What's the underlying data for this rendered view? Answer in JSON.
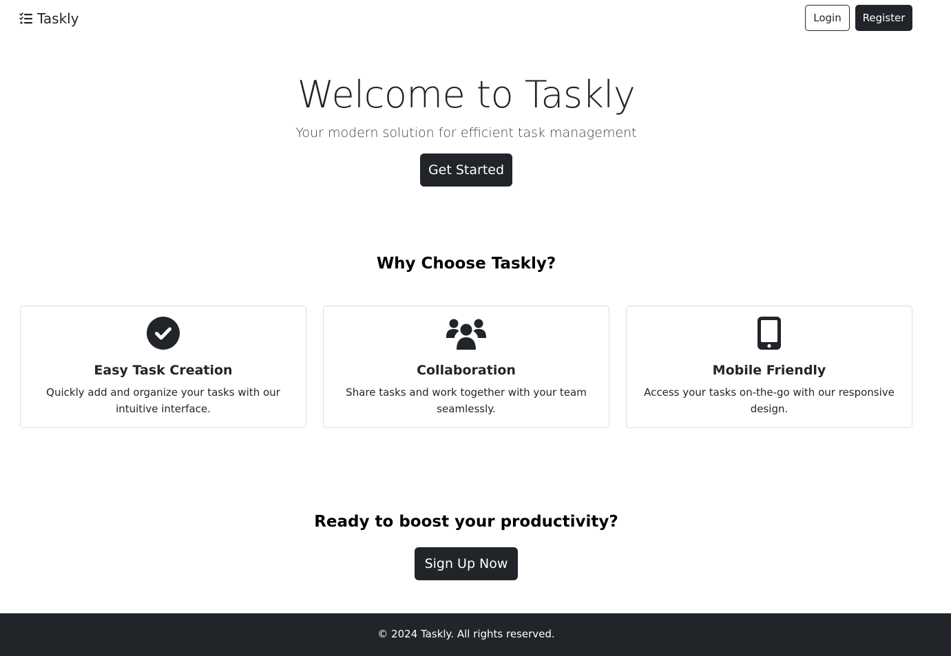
{
  "navbar": {
    "brand_icon": "task-list-icon",
    "brand_label": "Taskly",
    "login_label": "Login",
    "register_label": "Register"
  },
  "hero": {
    "title": "Welcome to Taskly",
    "subtitle": "Your modern solution for efficient task management",
    "cta_label": "Get Started"
  },
  "features": {
    "heading": "Why Choose Taskly?",
    "items": [
      {
        "icon": "check-circle-icon",
        "title": "Easy Task Creation",
        "text": "Quickly add and organize your tasks with our intuitive interface."
      },
      {
        "icon": "users-icon",
        "title": "Collaboration",
        "text": "Share tasks and work together with your team seamlessly."
      },
      {
        "icon": "mobile-icon",
        "title": "Mobile Friendly",
        "text": "Access your tasks on-the-go with our responsive design."
      }
    ]
  },
  "cta": {
    "heading": "Ready to boost your productivity?",
    "button_label": "Sign Up Now"
  },
  "footer": {
    "text": "© 2024 Taskly. All rights reserved."
  },
  "colors": {
    "dark": "#212529",
    "card_border": "#d9dcdf",
    "background": "#ffffff"
  }
}
